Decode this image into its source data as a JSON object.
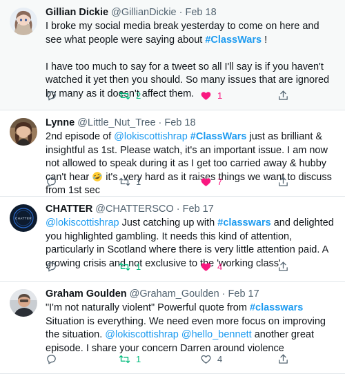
{
  "tweets": [
    {
      "name": "Gillian Dickie",
      "handle": "@GillianDickie",
      "sep": " · ",
      "date": "Feb 18",
      "body": {
        "p1": "I broke my social media break yesterday to come on here and see what people were saying about ",
        "tag1": "#ClassWars",
        "p2": " !\n\nI have too much to say for a tweet so all I'll say is if you haven't watched it yet then you should. So many issues that are ignored by many as it doesn't affect them."
      },
      "retweets": "2",
      "likes": "1"
    },
    {
      "name": "Lynne",
      "handle": "@Little_Nut_Tree",
      "sep": " · ",
      "date": "Feb 18",
      "body": {
        "p1": "2nd episode of ",
        "mention1": "@lokiscottishrap",
        "p2": " ",
        "tag1": "#ClassWars",
        "p3": " just as brilliant & insightful as 1st. Please watch, it's an important issue. I am now not allowed to speak during it as I get too carried away & hubby can't hear ",
        "p4": " it's  very hard as it raises things we want to discuss from 1st sec"
      },
      "retweets": "1",
      "likes": "7"
    },
    {
      "name": "CHATTER",
      "handle": "@CHATTERSCO",
      "sep": " · ",
      "date": "Feb 17",
      "avatar_text": "CHATTER",
      "body": {
        "mention1": "@lokiscottishrap",
        "p1": " Just catching up with ",
        "tag1": "#classwars",
        "p2": " and delighted you highlighted gambling. It needs this kind of attention, particularly in Scotland where there is very little attention paid. A growing crisis and not exclusive to the 'working class'"
      },
      "retweets": "1",
      "likes": "4"
    },
    {
      "name": "Graham Goulden",
      "handle": "@Graham_Goulden",
      "sep": " · ",
      "date": "Feb 17",
      "body": {
        "p1": "\"I'm not naturally violent\" Powerful quote from ",
        "tag1": "#classwars",
        "p2": " Situation is everything. We need even more focus on improving the situation. ",
        "mention1": "@lokiscottishrap",
        "p3": " ",
        "mention2": "@hello_bennett",
        "p4": " another great episode. I share your concern Darren around violence"
      },
      "retweets": "1",
      "likes": "4"
    }
  ],
  "colors": {
    "link": "#1d9bf0",
    "retweet_active": "#00ba7c",
    "like_active": "#f91880",
    "muted": "#536471"
  },
  "icons": [
    "reply-icon",
    "retweet-icon",
    "heart-icon",
    "share-icon"
  ]
}
